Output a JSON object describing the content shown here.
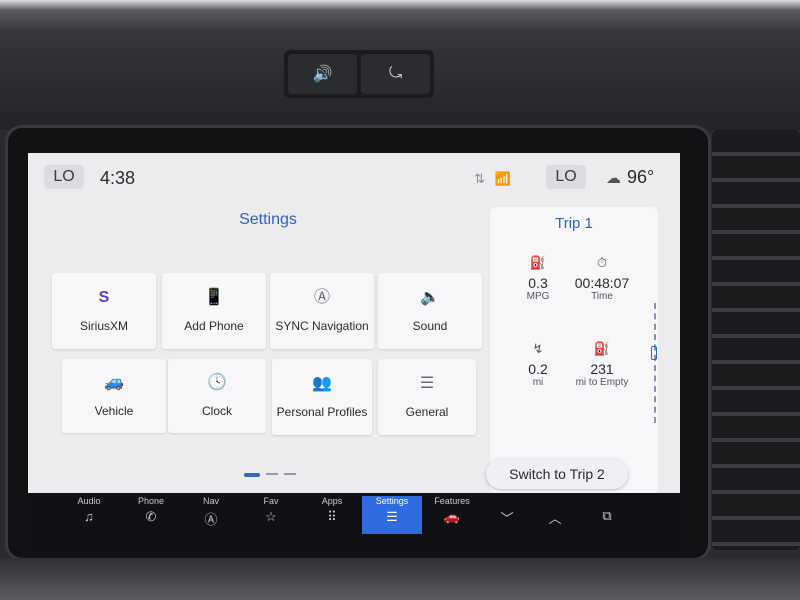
{
  "hardware": {
    "left_button_icon": "🔊",
    "right_button_icon": "⤿"
  },
  "status_bar": {
    "left_temp": "LO",
    "clock": "4:38",
    "status_icons": [
      "⇅",
      "📶"
    ],
    "right_temp": "LO",
    "weather_icon": "☁",
    "outside_temp": "96°"
  },
  "settings": {
    "title": "Settings",
    "tiles": [
      {
        "label": "SiriusXM",
        "icon": "S"
      },
      {
        "label": "Add Phone",
        "icon": "📱"
      },
      {
        "label": "SYNC Navigation",
        "icon": "Ⓐ"
      },
      {
        "label": "Sound",
        "icon": "🔈"
      },
      {
        "label": "Vehicle",
        "icon": "🚙"
      },
      {
        "label": "Clock",
        "icon": "🕓"
      },
      {
        "label": "Personal Profiles",
        "icon": "👥"
      },
      {
        "label": "General",
        "icon": "☰"
      }
    ]
  },
  "trip": {
    "title": "Trip 1",
    "stats": [
      {
        "value": "0.3",
        "unit": "MPG",
        "icon": "⛽"
      },
      {
        "value": "00:48:07",
        "unit": "Time",
        "icon": "⏱"
      },
      {
        "value": "0.2",
        "unit": "mi",
        "icon": "↯"
      },
      {
        "value": "231",
        "unit": "mi to Empty",
        "icon": "⛽"
      }
    ],
    "switch_button": "Switch to Trip 2"
  },
  "nav": {
    "items": [
      {
        "label": "Audio",
        "icon": "♫"
      },
      {
        "label": "Phone",
        "icon": "✆"
      },
      {
        "label": "Nav",
        "icon": "Ⓐ"
      },
      {
        "label": "Fav",
        "icon": "☆"
      },
      {
        "label": "Apps",
        "icon": "⠿"
      },
      {
        "label": "Settings",
        "icon": "☰"
      },
      {
        "label": "Features",
        "icon": "🚗"
      }
    ],
    "extra_icons": [
      "﹀",
      "︿",
      "⧉"
    ],
    "active": "Settings",
    "active_color": "#2f6be0"
  }
}
